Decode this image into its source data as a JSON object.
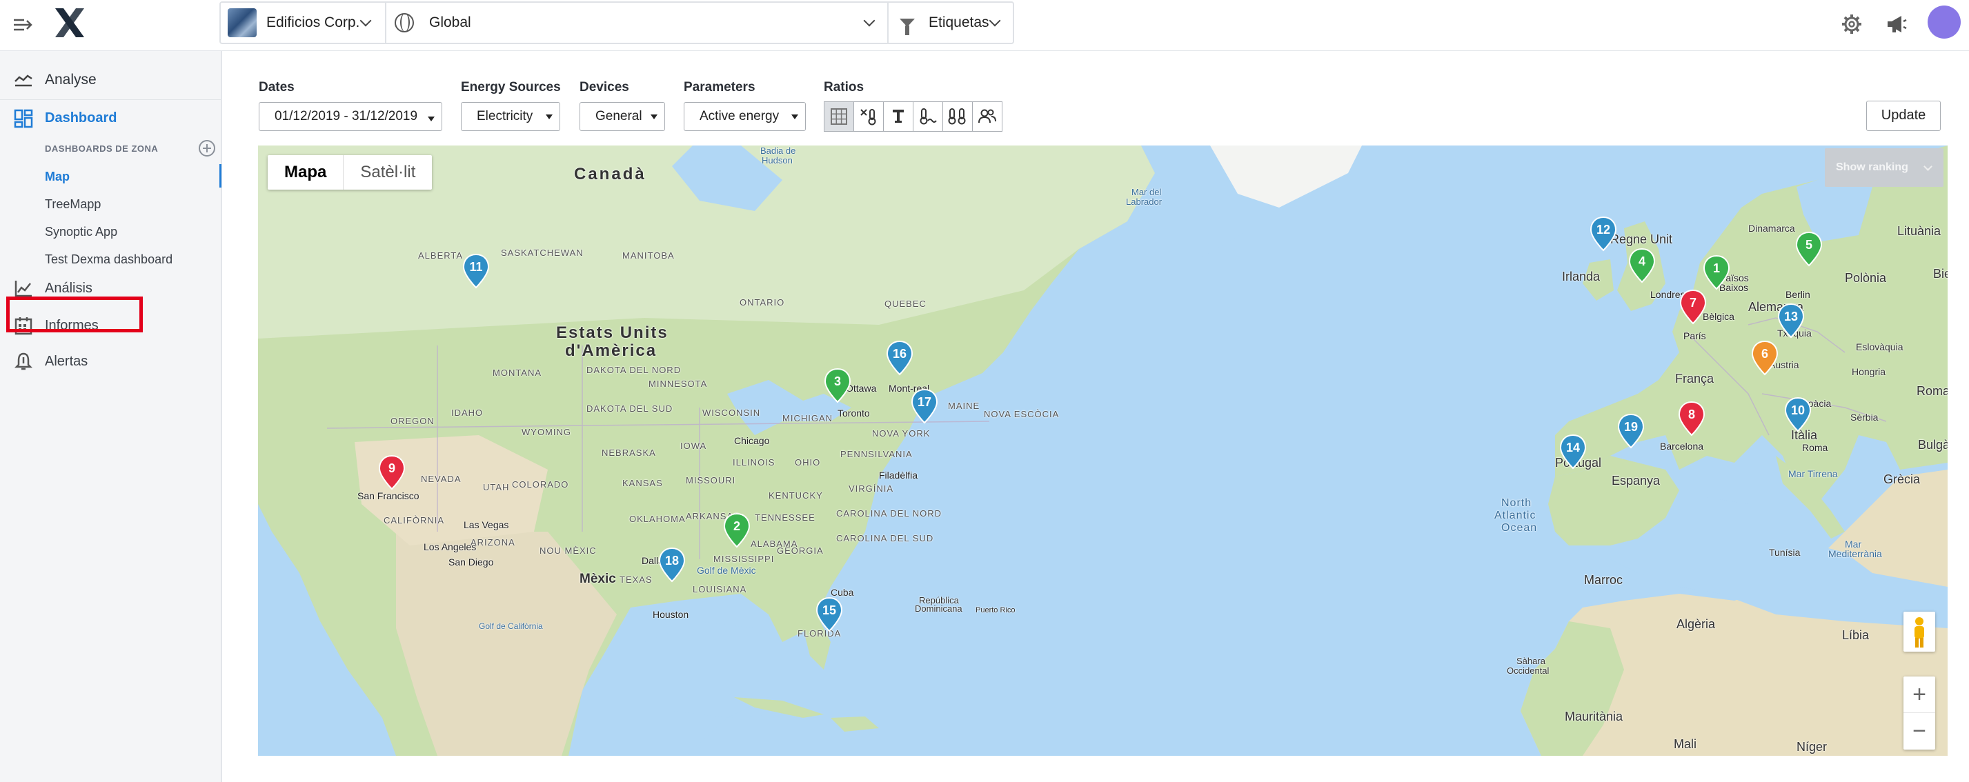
{
  "header": {
    "company": "Edificios Corp.",
    "scope": "Global",
    "tags": "Etiquetas",
    "icons": [
      "menu-collapse-icon",
      "logo",
      "settings-gear-icon",
      "megaphone-icon",
      "user-avatar"
    ]
  },
  "sidebar": {
    "analyse": "Analyse",
    "dashboard": "Dashboard",
    "zone_heading": "DASHBOARDS DE ZONA",
    "zone_items": [
      "Map",
      "TreeMapp",
      "Synoptic App",
      "Test Dexma dashboard"
    ],
    "analysis": "Análisis",
    "reports": "Informes",
    "alerts": "Alertas"
  },
  "filters": {
    "dates_label": "Dates",
    "dates_value": "01/12/2019 - 31/12/2019",
    "energy_label": "Energy Sources",
    "energy_value": "Electricity",
    "devices_label": "Devices",
    "devices_value": "General",
    "parameters_label": "Parameters",
    "parameters_value": "Active energy",
    "ratios_label": "Ratios",
    "update": "Update"
  },
  "map": {
    "tab_map": "Mapa",
    "tab_satellite": "Satèl·lit",
    "show_ranking": "Show ranking",
    "zoom_in": "+",
    "zoom_out": "−",
    "labels": {
      "canada": "Canadà",
      "usa1": "Estats Units",
      "usa2": "d'Amèrica",
      "mexico": "Mèxic",
      "cuba": "Cuba",
      "rep_dom1": "República",
      "rep_dom2": "Dominicana",
      "puerto_rico": "Puerto Rico",
      "gulf": "Golf de Mèxic",
      "gulf_cal": "Golf de Califòrnia",
      "north_atlantic1": "North",
      "north_atlantic2": "Atlantic",
      "north_atlantic3": "Ocean",
      "labrador1": "Mar del",
      "labrador2": "Labrador",
      "hudson1": "Badia de",
      "hudson2": "Hudson",
      "ontario": "ONTARIO",
      "quebec": "QUEBEC",
      "saskatchewan": "SASKATCHEWAN",
      "alberta": "ALBERTA",
      "manitoba": "MANITOBA",
      "minnesota": "MINNESOTA",
      "wisconsin": "WISCONSIN",
      "nebraska": "NEBRASKA",
      "colorado": "COLORADO",
      "kansas": "KANSAS",
      "texas": "TEXAS",
      "oregon": "OREGON",
      "idaho": "IDAHO",
      "wyoming": "WYOMING",
      "utah": "UTAH",
      "nuevo_mexico": "NOU MÈXIC",
      "arizona": "ARIZONA",
      "oklahoma": "OKLAHOMA",
      "missouri": "MISSOURI",
      "iowa": "IOWA",
      "illinois": "ILLINOIS",
      "michigan": "MICHIGAN",
      "ohio": "OHIO",
      "pennsylvania": "PENNSILVANIA",
      "new_york_state": "NOVA YORK",
      "virginia": "VIRGÍNIA",
      "carolina_n": "CAROLINA DEL NORD",
      "carolina_s": "CAROLINA DEL SUD",
      "tennessee": "TENNESSEE",
      "georgia": "GEORGIA",
      "alabama": "ALABAMA",
      "mississippi": "MISSISSIPPI",
      "louisiana": "LOUISIANA",
      "arkansas": "ARKANSAS",
      "kentucky": "KENTUCKY",
      "maine": "MAINE",
      "nova_scotia": "NOVA ESCÒCIA",
      "nevada": "NEVADA",
      "california": "CALIFÒRNIA",
      "montana": "MONTANA",
      "dakota_n": "DAKOTA DEL NORD",
      "dakota_s": "DAKOTA DEL SUD",
      "chicago": "Chicago",
      "toronto": "Toronto",
      "ottawa": "Ottawa",
      "montreal": "Mont-real",
      "filadelfia": "Filadèlfia",
      "dallas": "Dallas",
      "houston": "Houston",
      "las_vegas": "Las Vegas",
      "los_angeles": "Los Angeles",
      "san_diego": "San Diego",
      "san_francisco": "San Francisco",
      "florida": "FLORIDA",
      "regne_unit": "Regne Unit",
      "irlanda": "Irlanda",
      "londres": "Londres",
      "paisos_baixos1": "Països",
      "paisos_baixos2": "Baixos",
      "belgica": "Bèlgica",
      "paris": "París",
      "franca": "França",
      "alemanya": "Alemanya",
      "berlin": "Berlin",
      "dinamarca": "Dinamarca",
      "lituania": "Lituània",
      "polonia": "Polònia",
      "txequia": "Txèquia",
      "eslovaquia": "Eslovàquia",
      "austria": "Àustria",
      "hongria": "Hongria",
      "croacia": "Croàcia",
      "serbia": "Sèrbia",
      "romania": "Roman",
      "bulgaria": "Bulgà",
      "grecia": "Grècia",
      "italia": "Itàlia",
      "roma": "Roma",
      "mar_tirrena": "Mar Tirrena",
      "barcelona": "Barcelona",
      "espanya": "Espanya",
      "portugal": "Portugal",
      "mar_med1": "Mar",
      "mar_med2": "Mediterrània",
      "tunisia": "Tunísia",
      "marroc": "Marroc",
      "algeria": "Algèria",
      "libia": "Líbia",
      "sahara1": "Sàhara",
      "sahara2": "Occidental",
      "mauritania": "Mauritània",
      "mali": "Mali",
      "niger": "Níger",
      "bie": "Bie"
    },
    "markers": [
      {
        "n": "1",
        "color": "#37b24d"
      },
      {
        "n": "2",
        "color": "#37b24d"
      },
      {
        "n": "3",
        "color": "#37b24d"
      },
      {
        "n": "4",
        "color": "#37b24d"
      },
      {
        "n": "5",
        "color": "#37b24d"
      },
      {
        "n": "6",
        "color": "#f0912c"
      },
      {
        "n": "7",
        "color": "#e5293f"
      },
      {
        "n": "8",
        "color": "#e5293f"
      },
      {
        "n": "9",
        "color": "#e5293f"
      },
      {
        "n": "10",
        "color": "#2f8fc7"
      },
      {
        "n": "11",
        "color": "#2f8fc7"
      },
      {
        "n": "12",
        "color": "#2f8fc7"
      },
      {
        "n": "13",
        "color": "#2f8fc7"
      },
      {
        "n": "14",
        "color": "#2f8fc7"
      },
      {
        "n": "15",
        "color": "#2f8fc7"
      },
      {
        "n": "16",
        "color": "#2f8fc7"
      },
      {
        "n": "17",
        "color": "#2f8fc7"
      },
      {
        "n": "18",
        "color": "#2f8fc7"
      },
      {
        "n": "19",
        "color": "#2f8fc7"
      }
    ]
  }
}
